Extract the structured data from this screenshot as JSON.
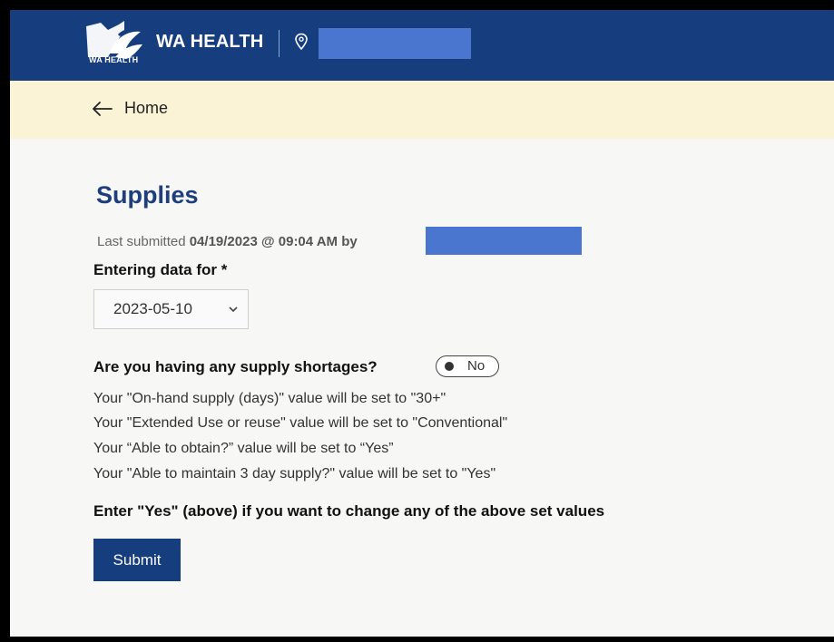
{
  "header": {
    "brand": "WA HEALTH",
    "logo_subtext": "WA HEALTH",
    "bar_color": "#163d7d",
    "redaction_color": "#4a76cf",
    "icons": [
      "logo-icon",
      "location-pin-icon"
    ]
  },
  "nav": {
    "back_label": "Home",
    "back_icon": "arrow-left-icon"
  },
  "page": {
    "title": "Supplies",
    "last_submitted_prefix": "Last submitted ",
    "last_submitted_value": "04/19/2023 @ 09:04 AM by"
  },
  "form": {
    "entering_label": "Entering data for *",
    "date_selected": "2023-05-10",
    "shortage_question": "Are you having any supply shortages?",
    "shortage_toggle": "No",
    "info_lines": [
      "Your \"On-hand supply (days)\" value will be set to \"30+\"",
      "Your \"Extended Use or reuse\" value will be set to \"Conventional\"",
      "Your “Able to obtain?” value will be set to “Yes”",
      "Your \"Able to maintain 3 day supply?\" value will be set to \"Yes\""
    ],
    "note": "Enter \"Yes\" (above) if you want to change any of the above set values",
    "submit_label": "Submit"
  }
}
